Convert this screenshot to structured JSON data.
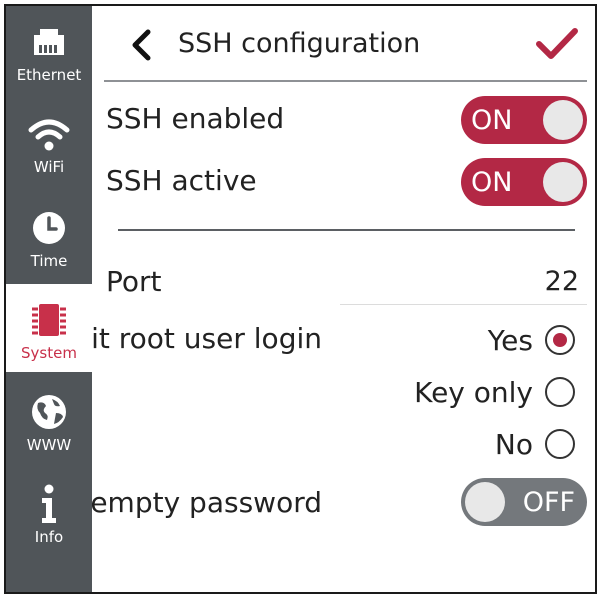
{
  "sidebar": {
    "items": [
      {
        "label": "Ethernet",
        "icon": "ethernet-icon"
      },
      {
        "label": "WiFi",
        "icon": "wifi-icon"
      },
      {
        "label": "Time",
        "icon": "clock-icon"
      },
      {
        "label": "System",
        "icon": "chip-icon",
        "active": true
      },
      {
        "label": "WWW",
        "icon": "globe-icon"
      },
      {
        "label": "Info",
        "icon": "info-icon"
      }
    ]
  },
  "header": {
    "title": "SSH configuration",
    "back_icon": "chevron-left-icon",
    "confirm_icon": "checkmark-icon"
  },
  "settings": {
    "ssh_enabled": {
      "label": "SSH enabled",
      "state": "ON"
    },
    "ssh_active": {
      "label": "SSH active",
      "state": "ON"
    },
    "port": {
      "label": "Port",
      "value": "22"
    },
    "root_login": {
      "label": "Permit root user login",
      "options": [
        "Yes",
        "Key only",
        "No"
      ],
      "selected": "Yes"
    },
    "empty_password": {
      "label": "Permit empty password",
      "state": "OFF"
    }
  },
  "colors": {
    "accent": "#b32845",
    "sidebar_bg": "#505559",
    "toggle_off": "#74787c"
  }
}
